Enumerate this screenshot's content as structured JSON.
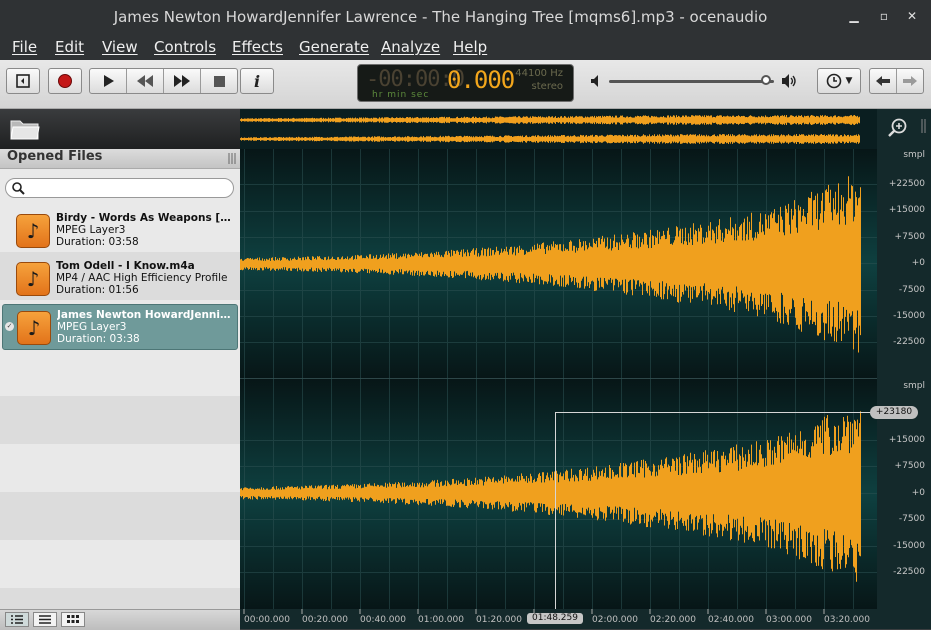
{
  "window": {
    "title": "James Newton HowardJennifer Lawrence - The Hanging Tree [mqms6].mp3 - ocenaudio"
  },
  "menu": [
    "File",
    "Edit",
    "View",
    "Controls",
    "Effects",
    "Generate",
    "Analyze",
    "Help"
  ],
  "display": {
    "dim_digits": "-00:00:0",
    "time": "0.000",
    "units": "hr   min sec",
    "rate": "44100 Hz",
    "channels": "stereo"
  },
  "volume_level": 0.95,
  "sidebar": {
    "title": "Opened Files",
    "search_placeholder": "",
    "files": [
      {
        "name": "Birdy - Words As Weapons [mqm…",
        "format": "MPEG Layer3",
        "duration": "Duration: 03:58"
      },
      {
        "name": "Tom Odell - I Know.m4a",
        "format": "MP4 / AAC High Efficiency Profile",
        "duration": "Duration: 01:56"
      },
      {
        "name": "James Newton HowardJennifer …",
        "format": "MPEG Layer3",
        "duration": "Duration: 03:38"
      }
    ]
  },
  "ruler": {
    "unit": "smpl",
    "top": [
      "+22500",
      "+15000",
      "+7500",
      "+0",
      "-7500",
      "-15000",
      "-22500"
    ],
    "bottom": [
      "+15000",
      "+7500",
      "+0",
      "-7500",
      "-15000",
      "-22500"
    ],
    "cursor_value": "+23180"
  },
  "timeline": {
    "labels": [
      "00:00.000",
      "00:20.000",
      "00:40.000",
      "01:00.000",
      "01:20.000",
      "02:00.000",
      "02:20.000",
      "02:40.000",
      "03:00.000",
      "03:20.000"
    ],
    "cursor_time": "01:48.259"
  },
  "colors": {
    "waveform": "#f0a01e",
    "waveform_bg": "#0e4040",
    "selection": "#6f9a9a"
  }
}
